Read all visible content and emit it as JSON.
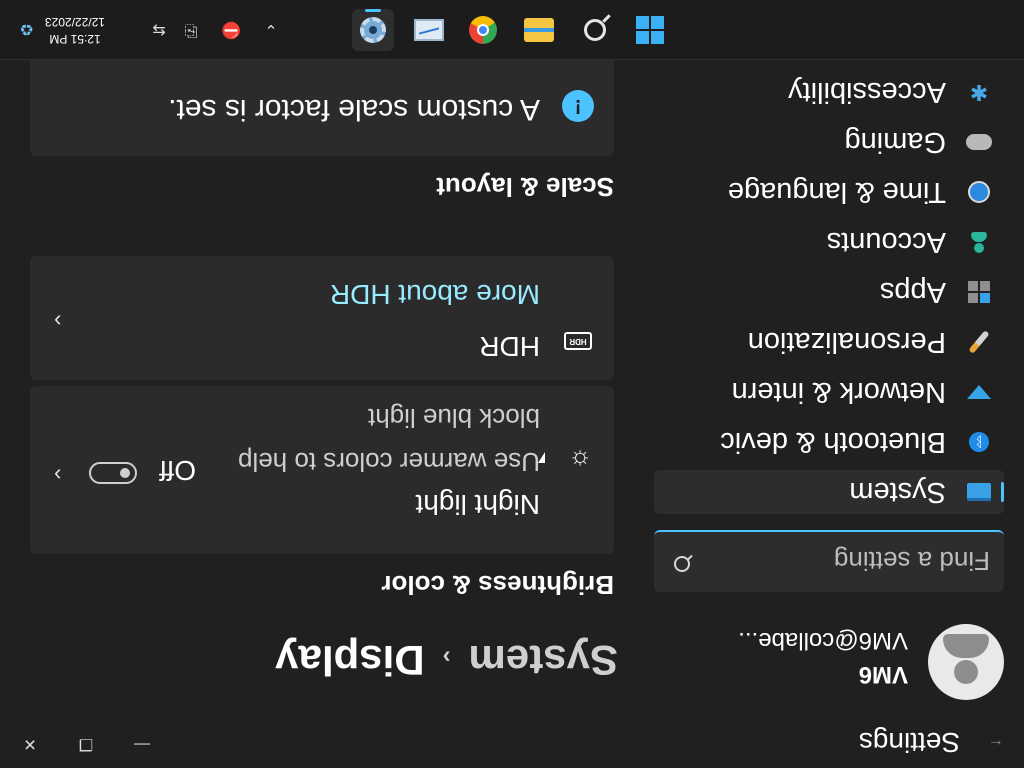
{
  "window": {
    "app_title": "Settings",
    "back_label": "←",
    "minimize_label": "—",
    "maximize_label": "❐",
    "close_label": "✕"
  },
  "profile": {
    "name": "VM6",
    "email": "VM6@collabe..."
  },
  "search": {
    "placeholder": "Find a setting"
  },
  "sidebar": {
    "items": [
      {
        "label": "System",
        "icon": "system-icon",
        "selected": true
      },
      {
        "label": "Bluetooth & devic",
        "icon": "bluetooth-icon"
      },
      {
        "label": "Network & intern",
        "icon": "network-icon"
      },
      {
        "label": "Personalization",
        "icon": "paintbrush-icon"
      },
      {
        "label": "Apps",
        "icon": "apps-icon"
      },
      {
        "label": "Accounts",
        "icon": "accounts-icon"
      },
      {
        "label": "Time & language",
        "icon": "globe-clock-icon"
      },
      {
        "label": "Gaming",
        "icon": "gamepad-icon"
      },
      {
        "label": "Accessibility",
        "icon": "accessibility-icon"
      }
    ]
  },
  "breadcrumb": {
    "parent": "System",
    "separator": "›",
    "current": "Display"
  },
  "brightness_section": {
    "title": "Brightness & color",
    "night_light": {
      "title": "Night light",
      "subtitle": "Use warmer colors to help block blue light",
      "state_label": "Off",
      "on": false,
      "icon": "sun-icon",
      "chevron": "›"
    },
    "hdr": {
      "title": "HDR",
      "badge": "HDR",
      "link": "More about HDR",
      "chevron": "›"
    }
  },
  "scale_section": {
    "title": "Scale & layout",
    "info": {
      "icon_glyph": "!",
      "text": "A custom scale factor is set."
    }
  },
  "taskbar": {
    "apps": [
      {
        "name": "start",
        "icon": "windows-logo-icon"
      },
      {
        "name": "search",
        "icon": "search-icon"
      },
      {
        "name": "file-explorer",
        "icon": "folder-icon"
      },
      {
        "name": "chrome",
        "icon": "chrome-icon"
      },
      {
        "name": "task-manager",
        "icon": "task-manager-icon"
      },
      {
        "name": "settings",
        "icon": "gear-icon",
        "active": true
      }
    ],
    "tray": {
      "chevron": "⌄",
      "network_glyph": "⛔",
      "usb_glyph": "⎘",
      "vm_glyph": "⇆",
      "time": "12:51 PM",
      "date": "12/22/2023",
      "recycle_glyph": "♻"
    }
  },
  "colors": {
    "accent": "#4cc2ff",
    "link": "#99ebff",
    "background": "#202020",
    "card": "#2b2b2b"
  },
  "display_rotation": "180deg"
}
